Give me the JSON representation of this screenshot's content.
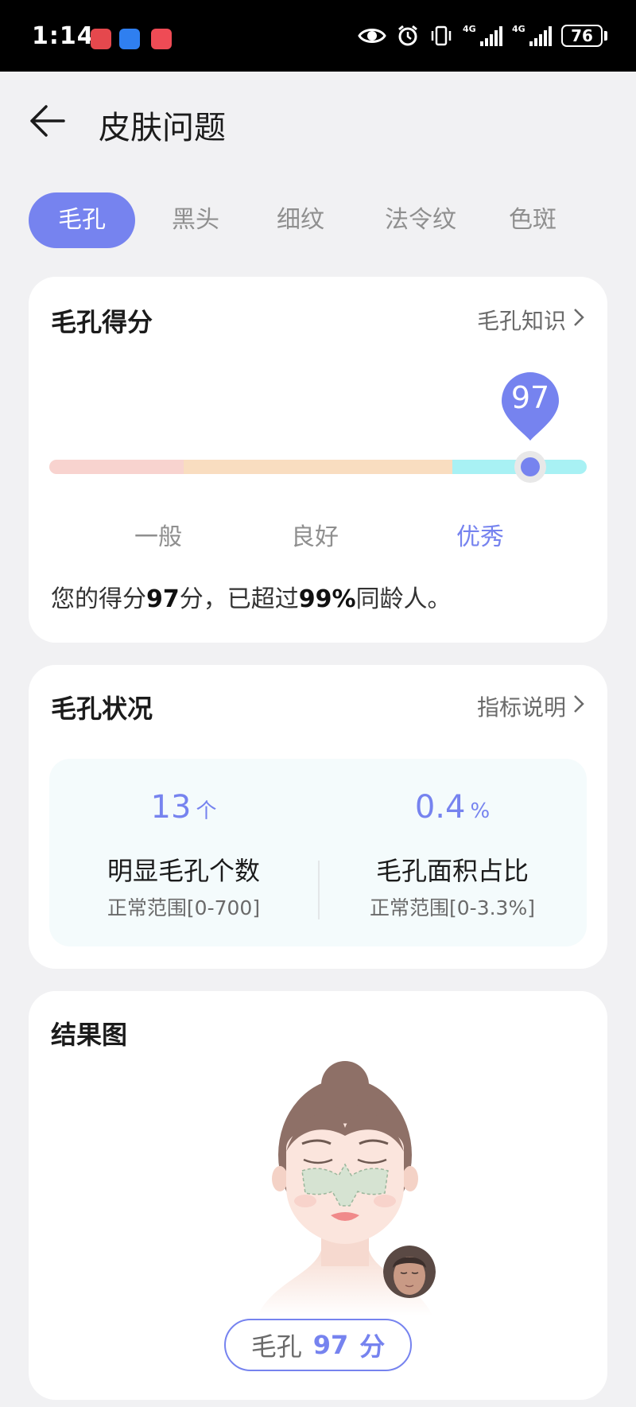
{
  "status_bar": {
    "time": "1:14",
    "network_1": "4G",
    "network_2": "4G",
    "battery": "76"
  },
  "header": {
    "title": "皮肤问题"
  },
  "tabs": [
    {
      "label": "毛孔",
      "active": true
    },
    {
      "label": "黑头",
      "active": false
    },
    {
      "label": "细纹",
      "active": false
    },
    {
      "label": "法令纹",
      "active": false
    },
    {
      "label": "色斑",
      "active": false
    }
  ],
  "score_card": {
    "title": "毛孔得分",
    "link": "毛孔知识",
    "score": "97",
    "score_fraction": 0.895,
    "levels": [
      "一般",
      "良好",
      "优秀"
    ],
    "summary_prefix": "您的得分",
    "summary_score": "97",
    "summary_middle": "分，已超过",
    "summary_percent": "99%",
    "summary_suffix": "同龄人。"
  },
  "status_card": {
    "title": "毛孔状况",
    "link": "指标说明",
    "metrics": [
      {
        "value": "13",
        "unit": "个",
        "name": "明显毛孔个数",
        "range": "正常范围[0-700]"
      },
      {
        "value": "0.4",
        "unit": "%",
        "name": "毛孔面积占比",
        "range": "正常范围[0-3.3%]"
      }
    ]
  },
  "result_card": {
    "title": "结果图",
    "pill_label": "毛孔",
    "pill_score": "97",
    "pill_unit": "分"
  },
  "colors": {
    "accent": "#7683ef",
    "bar_low": "#f8d3cf",
    "bar_mid": "#f9ddc0",
    "bar_high": "#a8f1f4"
  }
}
